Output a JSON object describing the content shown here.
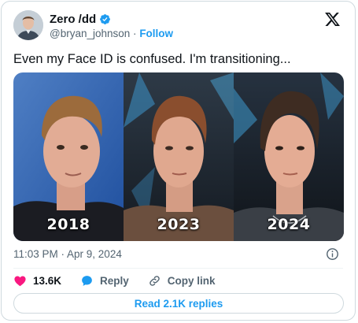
{
  "author": {
    "name": "Zero /dd",
    "handle": "@bryan_johnson",
    "separator": "·",
    "follow_label": "Follow"
  },
  "tweet": {
    "text": "Even my Face ID is confused. I'm transitioning...",
    "timestamp": "11:03 PM · Apr 9, 2024"
  },
  "media": {
    "panels": [
      {
        "year": "2018"
      },
      {
        "year": "2023"
      },
      {
        "year": "2024"
      }
    ]
  },
  "actions": {
    "likes": "13.6K",
    "reply_label": "Reply",
    "copy_link_label": "Copy link"
  },
  "replies_button": "Read 2.1K replies",
  "colors": {
    "accent": "#1d9bf0",
    "like": "#f91880",
    "text": "#0f1419",
    "muted": "#536471",
    "border": "#cfd9de"
  },
  "icons": [
    "verified-badge-icon",
    "x-logo-icon",
    "info-icon",
    "heart-icon",
    "reply-bubble-icon",
    "link-icon"
  ]
}
